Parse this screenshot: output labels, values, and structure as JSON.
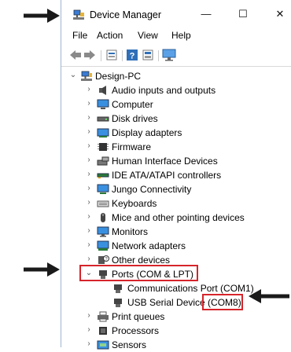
{
  "window": {
    "title": "Device Manager",
    "controls": {
      "minimize": "—",
      "maximize": "☐",
      "close": "✕"
    }
  },
  "menu": [
    "File",
    "Action",
    "View",
    "Help"
  ],
  "toolbar": [
    "back-icon",
    "forward-icon",
    "properties-icon",
    "help-icon",
    "view-icon",
    "monitor-icon"
  ],
  "tree": {
    "root": "Design-PC",
    "items": [
      {
        "label": "Audio inputs and outputs",
        "icon": "speaker-icon",
        "state": "collapsed"
      },
      {
        "label": "Computer",
        "icon": "computer-icon",
        "state": "collapsed"
      },
      {
        "label": "Disk drives",
        "icon": "disk-icon",
        "state": "collapsed"
      },
      {
        "label": "Display adapters",
        "icon": "display-adapter-icon",
        "state": "collapsed"
      },
      {
        "label": "Firmware",
        "icon": "firmware-icon",
        "state": "collapsed"
      },
      {
        "label": "Human Interface Devices",
        "icon": "hid-icon",
        "state": "collapsed"
      },
      {
        "label": "IDE ATA/ATAPI controllers",
        "icon": "ide-icon",
        "state": "collapsed"
      },
      {
        "label": "Jungo Connectivity",
        "icon": "jungo-icon",
        "state": "collapsed"
      },
      {
        "label": "Keyboards",
        "icon": "keyboard-icon",
        "state": "collapsed"
      },
      {
        "label": "Mice and other pointing devices",
        "icon": "mouse-icon",
        "state": "collapsed"
      },
      {
        "label": "Monitors",
        "icon": "monitor-icon",
        "state": "collapsed"
      },
      {
        "label": "Network adapters",
        "icon": "network-icon",
        "state": "collapsed"
      },
      {
        "label": "Other devices",
        "icon": "other-devices-icon",
        "state": "collapsed"
      },
      {
        "label": "Ports (COM & LPT)",
        "icon": "port-icon",
        "state": "expanded"
      },
      {
        "label": "Communications Port (COM1)",
        "icon": "port-device-icon",
        "state": "child"
      },
      {
        "label": "USB Serial Device (COM8)",
        "icon": "port-device-icon",
        "state": "child"
      },
      {
        "label": "Print queues",
        "icon": "printer-icon",
        "state": "collapsed"
      },
      {
        "label": "Processors",
        "icon": "processor-icon",
        "state": "collapsed"
      },
      {
        "label": "Sensors",
        "icon": "sensor-icon",
        "state": "collapsed"
      }
    ]
  },
  "usb_device": {
    "name": "USB Serial Device ",
    "port": "(COM8)"
  },
  "colors": {
    "highlight": "#d6242a",
    "arrow": "#1a1a1a",
    "accent": "#1e73c8"
  }
}
